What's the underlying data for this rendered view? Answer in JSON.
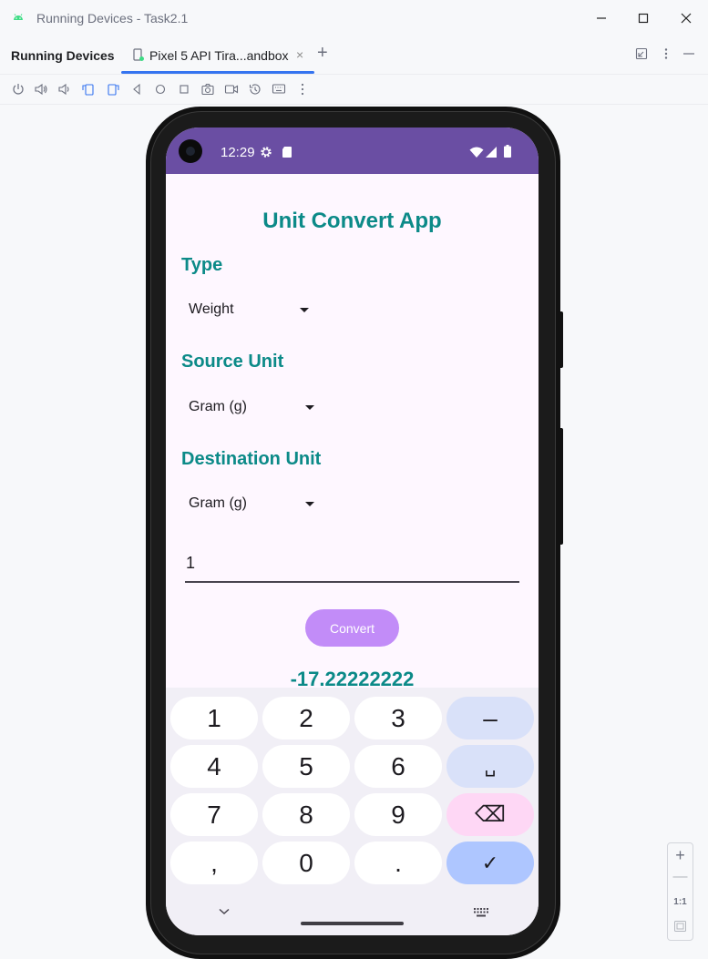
{
  "window": {
    "title": "Running Devices - Task2.1",
    "controls": [
      "minimize-icon",
      "maximize-icon",
      "close-icon"
    ]
  },
  "tool_window": {
    "title": "Running Devices",
    "tab": {
      "label": "Pixel 5 API Tira...andbox",
      "close": "×"
    },
    "add_tab": "+",
    "header_actions": [
      "collapse-icon",
      "more-vert-icon",
      "hide-icon"
    ]
  },
  "toolbar": {
    "buttons": [
      "power-icon",
      "volume-up-icon",
      "volume-down-icon",
      "rotate-left-icon",
      "rotate-right-icon",
      "back-icon",
      "home-icon",
      "overview-icon",
      "screenshot-icon",
      "screen-record-icon",
      "reset-icon",
      "keyboard-icon",
      "more-icon"
    ]
  },
  "device": {
    "status_bar": {
      "time": "12:29",
      "icons": [
        "settings-icon",
        "sd-card-icon",
        "wifi-icon",
        "signal-icon",
        "battery-icon"
      ],
      "color": "#6a4ea3"
    },
    "app": {
      "title": "Unit Convert App",
      "type_label": "Type",
      "type_value": "Weight",
      "source_label": "Source Unit",
      "source_value": "Gram (g)",
      "destination_label": "Destination Unit",
      "destination_value": "Gram (g)",
      "input_value": "1",
      "convert_label": "Convert",
      "result": "-17.22222222",
      "accent_color": "#0c8a88",
      "button_color": "#c28cf8"
    },
    "keyboard": {
      "rows": [
        [
          "1",
          "2",
          "3",
          "–"
        ],
        [
          "4",
          "5",
          "6",
          "␣"
        ],
        [
          "7",
          "8",
          "9",
          "⌫"
        ],
        [
          ",",
          "0",
          ".",
          "✓"
        ]
      ]
    }
  },
  "zoom_controls": {
    "zoom_in": "+",
    "zoom_out": "—",
    "actual_size": "1:1"
  }
}
